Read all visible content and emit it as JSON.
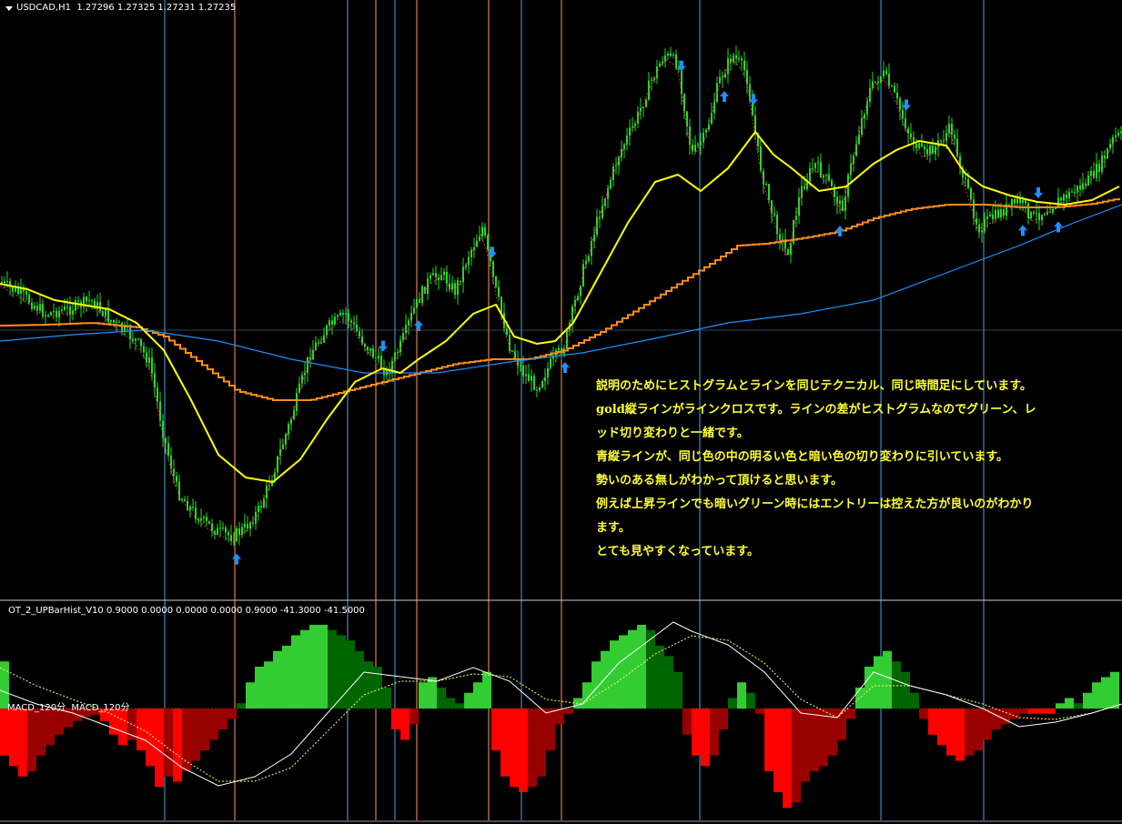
{
  "header": {
    "symbol_tf": "USDCAD,H1",
    "quotes": "1.27296 1.27325 1.27231 1.27235"
  },
  "subwindow": {
    "indicator_label": "OT_2_UPBarHist_V10 0.9000 0.0000 0.0000 0.0000 0.9000 -41.3000 -41.5000",
    "macd_label": "MACD_120分  MACD_120分"
  },
  "note": {
    "lines": [
      "説明のためにヒストグラムとラインを同じテクニカル、同じ時間足にしています。",
      "gold縦ラインがラインクロスです。ラインの差がヒストグラムなのでグリーン、レ",
      "ッド切り変わりと一緒です。",
      "青縦ラインが、同じ色の中の明るい色と暗い色の切り変わりに引いています。",
      "勢いのある無しがわかって頂けると思います。",
      "例えば上昇ラインでも暗いグリーン時にはエントリーは控えた方が良いのがわかり",
      "ます。",
      "とても見やすくなっています。"
    ]
  },
  "colors": {
    "background": "#000000",
    "candle": "#22dd22",
    "ma_fast": "#ffff00",
    "ma_step": "#ff8c1a",
    "ma_slow": "#1e90ff",
    "ma_dotted": "#ff3070",
    "arrow": "#1e90ff",
    "hist_bright_green": "#33cc33",
    "hist_dark_green": "#006600",
    "hist_bright_red": "#ff0000",
    "hist_dark_red": "#990000",
    "vline_blue": "#4aa3df",
    "vline_gold": "#ff9966",
    "note_text": "#ffff33"
  },
  "chart_data": {
    "type": "line",
    "x_range": [
      0,
      1233
    ],
    "price_series": {
      "name": "",
      "x": [
        0,
        25,
        50,
        75,
        100,
        125,
        150,
        165,
        180,
        195,
        210,
        225,
        240,
        255,
        270,
        285,
        300,
        320,
        340,
        360,
        380,
        395,
        410,
        425,
        440,
        455,
        470,
        485,
        500,
        515,
        530,
        545,
        560,
        575,
        590,
        605,
        620,
        640,
        660,
        680,
        700,
        715,
        730,
        745,
        760,
        775,
        790,
        805,
        820,
        835,
        850,
        865,
        880,
        895,
        910,
        925,
        940,
        955,
        970,
        985,
        1000,
        1015,
        1030,
        1045,
        1060,
        1075,
        1090,
        1105,
        1120,
        1135,
        1150,
        1165,
        1180,
        1195,
        1210,
        1225
      ],
      "y": [
        310,
        325,
        345,
        340,
        330,
        355,
        375,
        400,
        480,
        540,
        560,
        575,
        585,
        590,
        580,
        560,
        520,
        460,
        390,
        360,
        345,
        370,
        390,
        410,
        380,
        340,
        310,
        300,
        320,
        280,
        250,
        320,
        380,
        410,
        425,
        400,
        380,
        300,
        230,
        170,
        130,
        90,
        60,
        70,
        170,
        150,
        90,
        60,
        80,
        180,
        240,
        280,
        210,
        180,
        200,
        230,
        160,
        100,
        80,
        110,
        150,
        170,
        160,
        140,
        200,
        250,
        240,
        230,
        220,
        240,
        230,
        220,
        210,
        200,
        180,
        150
      ]
    },
    "ma_fast": {
      "name": "",
      "x": [
        0,
        30,
        60,
        90,
        120,
        150,
        180,
        210,
        240,
        270,
        300,
        330,
        360,
        390,
        420,
        440,
        460,
        490,
        520,
        545,
        565,
        590,
        610,
        630,
        660,
        690,
        720,
        745,
        770,
        800,
        830,
        850,
        870,
        900,
        930,
        960,
        985,
        1010,
        1040,
        1060,
        1080,
        1110,
        1140,
        1170,
        1200,
        1230
      ],
      "y": [
        312,
        318,
        330,
        335,
        340,
        355,
        385,
        440,
        500,
        525,
        530,
        505,
        460,
        420,
        405,
        410,
        395,
        375,
        345,
        335,
        370,
        378,
        375,
        355,
        300,
        245,
        200,
        192,
        210,
        185,
        145,
        170,
        185,
        210,
        205,
        180,
        165,
        155,
        160,
        190,
        205,
        215,
        222,
        225,
        220,
        205
      ]
    },
    "ma_step": {
      "name": "",
      "x": [
        0,
        50,
        100,
        150,
        180,
        220,
        260,
        300,
        340,
        380,
        420,
        460,
        500,
        540,
        580,
        620,
        660,
        700,
        740,
        780,
        810,
        840,
        880,
        920,
        960,
        1000,
        1040,
        1080,
        1120,
        1160,
        1200,
        1230
      ],
      "y": [
        358,
        357,
        355,
        360,
        370,
        400,
        430,
        440,
        440,
        430,
        420,
        410,
        400,
        395,
        395,
        385,
        365,
        340,
        315,
        290,
        270,
        268,
        262,
        255,
        240,
        230,
        225,
        225,
        228,
        228,
        224,
        218
      ]
    },
    "ma_slow": {
      "name": "",
      "x": [
        0,
        80,
        160,
        240,
        320,
        400,
        480,
        560,
        640,
        720,
        800,
        880,
        960,
        1040,
        1120,
        1180,
        1233
      ],
      "y": [
        375,
        368,
        363,
        375,
        395,
        410,
        410,
        398,
        388,
        372,
        355,
        345,
        330,
        300,
        270,
        245,
        225
      ]
    },
    "arrows_down_x": [
      421,
      541,
      749,
      828,
      996,
      1141
    ],
    "arrows_up_x": [
      260,
      460,
      621,
      796,
      923,
      1124,
      1163
    ],
    "vlines_blue_x": [
      181,
      382,
      434,
      573,
      769,
      968,
      1081
    ],
    "vlines_gold_x": [
      258,
      413,
      458,
      537,
      617
    ],
    "histogram": {
      "x": [
        0,
        10,
        20,
        30,
        40,
        50,
        60,
        70,
        80,
        90,
        100,
        110,
        120,
        130,
        140,
        150,
        160,
        170,
        180,
        190,
        200,
        210,
        220,
        230,
        240,
        250,
        260,
        270,
        280,
        290,
        300,
        310,
        320,
        330,
        340,
        350,
        360,
        370,
        380,
        390,
        400,
        410,
        420,
        430,
        440,
        450,
        460,
        470,
        480,
        490,
        500,
        510,
        520,
        530,
        540,
        550,
        560,
        570,
        580,
        590,
        600,
        610,
        620,
        630,
        640,
        650,
        660,
        670,
        680,
        690,
        700,
        710,
        720,
        730,
        740,
        750,
        760,
        770,
        780,
        790,
        800,
        810,
        820,
        830,
        840,
        850,
        860,
        870,
        880,
        890,
        900,
        910,
        920,
        930,
        940,
        950,
        960,
        970,
        980,
        990,
        1000,
        1010,
        1020,
        1030,
        1040,
        1050,
        1060,
        1070,
        1080,
        1090,
        1100,
        1110,
        1120,
        1130,
        1140,
        1150,
        1160,
        1170,
        1180,
        1190,
        1200,
        1210,
        1220
      ],
      "values": [
        -45,
        -55,
        -65,
        -60,
        -45,
        -35,
        -25,
        -18,
        -12,
        -8,
        -6,
        -12,
        -25,
        -35,
        -30,
        -40,
        -55,
        -75,
        -65,
        -70,
        -60,
        -50,
        -40,
        -30,
        -20,
        -10,
        5,
        25,
        40,
        45,
        55,
        60,
        70,
        75,
        80,
        80,
        75,
        70,
        65,
        55,
        45,
        40,
        20,
        -20,
        -30,
        -15,
        25,
        30,
        20,
        10,
        5,
        15,
        25,
        35,
        -40,
        -65,
        -75,
        -80,
        -75,
        -65,
        -40,
        -15,
        -5,
        10,
        25,
        45,
        55,
        65,
        70,
        75,
        80,
        75,
        60,
        50,
        35,
        -25,
        -45,
        -55,
        -45,
        -20,
        10,
        25,
        15,
        -5,
        -60,
        -80,
        -95,
        -90,
        -70,
        -60,
        -55,
        -45,
        -30,
        -10,
        20,
        40,
        50,
        55,
        45,
        35,
        15,
        -10,
        -25,
        -35,
        -45,
        -50,
        -45,
        -40,
        -30,
        -20,
        -15,
        -10,
        -5,
        -5,
        -5,
        -5,
        5,
        10,
        5,
        15,
        25,
        30,
        35,
        40,
        45
      ]
    },
    "macd_line": {
      "name": "",
      "x": [
        0,
        40,
        80,
        120,
        160,
        200,
        240,
        280,
        320,
        360,
        400,
        440,
        480,
        520,
        560,
        600,
        640,
        680,
        720,
        740,
        760,
        800,
        840,
        880,
        920,
        960,
        1000,
        1040,
        1080,
        1120,
        1160,
        1200,
        1233
      ],
      "y": [
        20,
        5,
        -5,
        -20,
        -35,
        -65,
        -85,
        -75,
        -50,
        -5,
        40,
        35,
        30,
        45,
        30,
        -5,
        5,
        50,
        80,
        95,
        85,
        70,
        40,
        -5,
        -10,
        40,
        25,
        15,
        0,
        -20,
        -15,
        -5,
        5
      ]
    },
    "signal_line": {
      "name": "",
      "x": [
        0,
        40,
        80,
        120,
        160,
        200,
        240,
        280,
        320,
        360,
        400,
        440,
        480,
        520,
        560,
        600,
        640,
        680,
        720,
        760,
        800,
        840,
        880,
        920,
        960,
        1000,
        1040,
        1080,
        1120,
        1160,
        1200,
        1233
      ],
      "y": [
        45,
        25,
        10,
        -5,
        -25,
        -55,
        -80,
        -80,
        -65,
        -25,
        15,
        30,
        30,
        38,
        35,
        10,
        5,
        30,
        60,
        80,
        75,
        50,
        10,
        -10,
        25,
        25,
        15,
        5,
        -10,
        -12,
        -5,
        5
      ]
    }
  }
}
